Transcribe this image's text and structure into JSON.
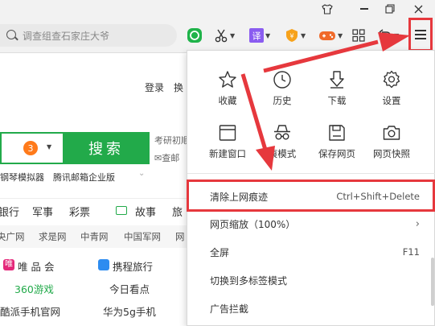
{
  "toolbar": {
    "search_placeholder": "调查组查石家庄大爷"
  },
  "page": {
    "login": "登录",
    "huan": "换",
    "kaoyan": "考研初顺",
    "email_note": "查邮",
    "badge": "3",
    "search_button": "搜索",
    "tools": [
      "钢琴模拟器",
      "腾讯邮箱企业版"
    ],
    "nav": [
      "银行",
      "军事",
      "彩票",
      "故事",
      "旅"
    ],
    "sites": [
      "央广网",
      "求是网",
      "中青网",
      "中国军网",
      "网"
    ],
    "grid": {
      "vip": "唯 品 会",
      "ctrip": "携程旅行",
      "game360": "360游戏",
      "today": "今日看点",
      "kupai": "酷派手机官网",
      "huawei": "华为5g手机"
    }
  },
  "menu": {
    "tiles": [
      {
        "label": "收藏",
        "icon": "star-icon"
      },
      {
        "label": "历史",
        "icon": "clock-icon"
      },
      {
        "label": "下载",
        "icon": "download-icon"
      },
      {
        "label": "设置",
        "icon": "gear-icon"
      },
      {
        "label": "新建窗口",
        "icon": "window-icon"
      },
      {
        "label": "痕模式",
        "icon": "incognito-icon"
      },
      {
        "label": "保存网页",
        "icon": "save-icon"
      },
      {
        "label": "网页快照",
        "icon": "camera-icon"
      }
    ],
    "items": [
      {
        "label": "清除上网痕迹",
        "shortcut": "Ctrl+Shift+Delete"
      },
      {
        "label": "网页缩放（100%）",
        "shortcut": ""
      },
      {
        "label": "全屏",
        "shortcut": "F11"
      },
      {
        "label": "切换到多标签模式",
        "shortcut": ""
      },
      {
        "label": "广告拦截",
        "shortcut": ""
      }
    ]
  },
  "colors": {
    "accent_green": "#22aa4a",
    "annotation_red": "#e6383d"
  }
}
